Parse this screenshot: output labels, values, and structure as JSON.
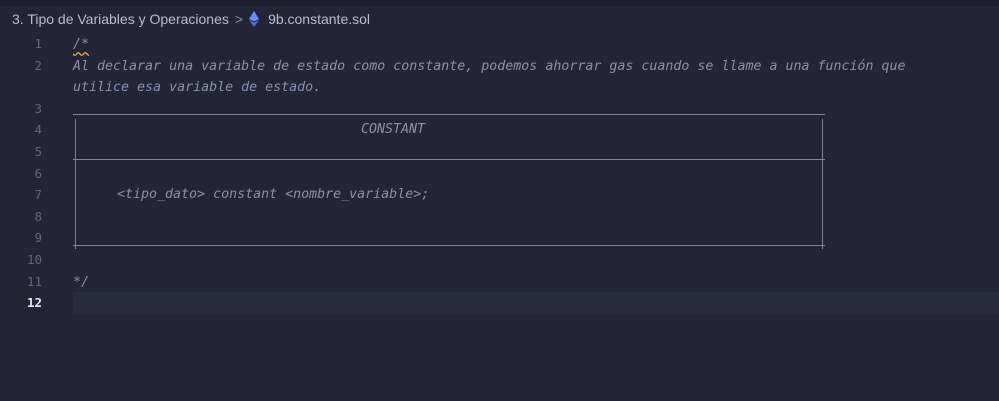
{
  "breadcrumb": {
    "folder": "3. Tipo de Variables y Operaciones",
    "separator": ">",
    "file_icon": "ethereum-icon",
    "file": "9b.constante.sol"
  },
  "editor": {
    "current_line": "12",
    "lines": [
      {
        "n": "1",
        "text": "/*"
      },
      {
        "n": "2",
        "text": "Al declarar una variable de estado como constante, podemos ahorrar gas cuando se llame a una función que"
      },
      {
        "n": "",
        "text": "utilice esa variable de estado."
      },
      {
        "n": "3",
        "text": ""
      },
      {
        "n": "4",
        "text": "CONSTANT"
      },
      {
        "n": "5",
        "text": ""
      },
      {
        "n": "6",
        "text": ""
      },
      {
        "n": "7",
        "text": "<tipo_dato> constant <nombre_variable>;"
      },
      {
        "n": "8",
        "text": ""
      },
      {
        "n": "9",
        "text": ""
      },
      {
        "n": "10",
        "text": ""
      },
      {
        "n": "11",
        "text": "*/"
      },
      {
        "n": "12",
        "text": ""
      }
    ]
  },
  "colors": {
    "background": "#232537",
    "comment": "#8a90ad",
    "line_number": "#5f6580",
    "current_line_number": "#e6e8f2",
    "ethereum_icon": "#6b8cff"
  }
}
